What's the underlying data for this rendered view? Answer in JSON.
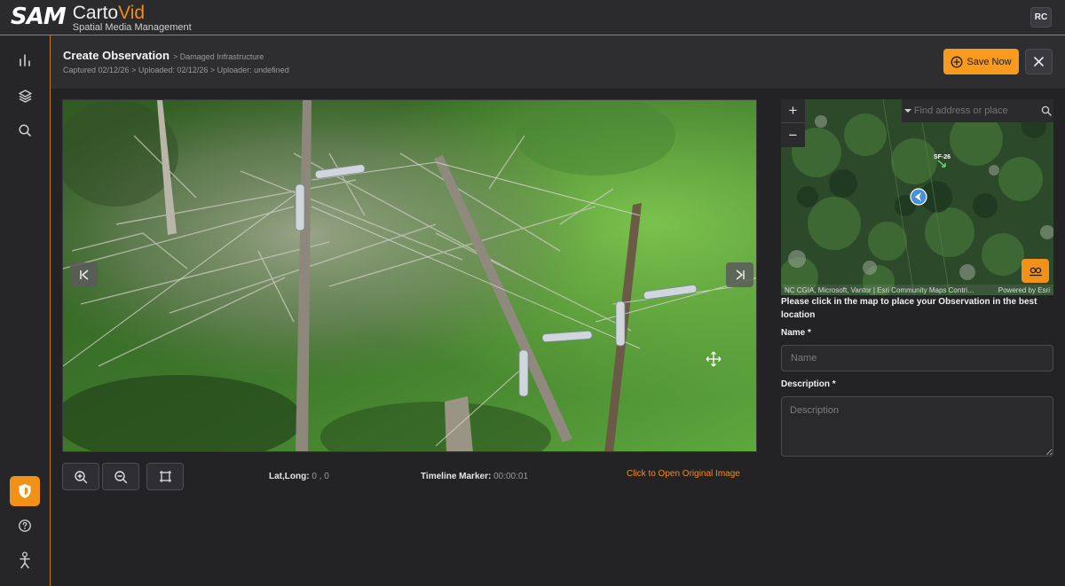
{
  "app": {
    "brand": "SAM",
    "title_prefix": "Carto",
    "title_accent": "Vid",
    "subtitle": "Spatial Media Management",
    "user_initials": "RC",
    "accent_color": "#f29118"
  },
  "sidebar": {
    "items": [
      {
        "icon": "bar-chart-icon"
      },
      {
        "icon": "layers-icon"
      },
      {
        "icon": "search-icon"
      },
      {
        "icon": "shield-badge-icon",
        "active": true
      },
      {
        "icon": "help-icon"
      },
      {
        "icon": "figure-icon"
      }
    ]
  },
  "header": {
    "title": "Create Observation",
    "breadcrumb": "> Damaged Infrastructure",
    "meta": "Captured 02/12/26 > Uploaded: 02/12/26 > Uploader: undefined",
    "save_label": "Save Now"
  },
  "viewer": {
    "lat_long_label": "Lat,Long:",
    "lat_long_value": "0 , 0",
    "timeline_label": "Timeline Marker:",
    "timeline_value": "00:00:01",
    "open_original_label": "Click to Open Original Image"
  },
  "map": {
    "search_placeholder": "Find address or place",
    "zoom_in": "+",
    "zoom_out": "−",
    "label": "SF-26",
    "attribution": "NC CGIA, Microsoft, Vantor | Esri Community Maps Contri…",
    "powered_by": "Powered by Esri"
  },
  "form": {
    "hint": "Please click in the map to place your Observation in the best location",
    "name_label": "Name *",
    "name_placeholder": "Name",
    "description_label": "Description *",
    "description_placeholder": "Description"
  }
}
